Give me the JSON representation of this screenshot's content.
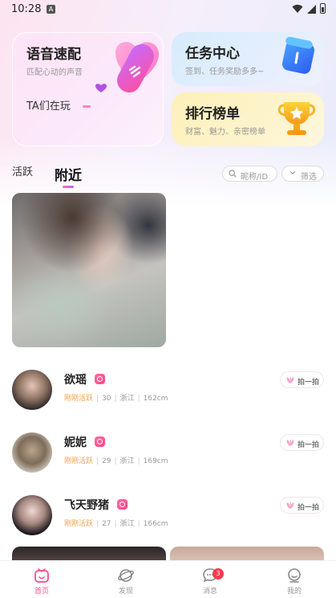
{
  "status_bar": {
    "time": "10:28",
    "notification_letter": "A"
  },
  "cards": {
    "voice_match": {
      "title": "语音速配",
      "subtitle": "匹配心动的声音",
      "tagline": "TA们在玩"
    },
    "task_center": {
      "title": "任务中心",
      "subtitle": "签到、任务奖励多多~"
    },
    "leaderboard": {
      "title": "排行榜单",
      "subtitle": "财富、魅力、亲密榜单"
    }
  },
  "tabs": [
    {
      "label": "活跃",
      "active": false
    },
    {
      "label": "附近",
      "active": true
    }
  ],
  "search": {
    "placeholder": "昵称/ID"
  },
  "filter": {
    "label": "筛选"
  },
  "users": [
    {
      "name": "欲瑶",
      "status": "刚刚活跃",
      "age": "30",
      "location": "浙江",
      "height": "162cm",
      "action": "拍一拍"
    },
    {
      "name": "妮妮",
      "status": "刚刚活跃",
      "age": "29",
      "location": "浙江",
      "height": "169cm",
      "action": "拍一拍"
    },
    {
      "name": "飞天野猪",
      "status": "刚刚活跃",
      "age": "27",
      "location": "浙江",
      "height": "166cm",
      "action": "拍一拍"
    }
  ],
  "bottom_nav": [
    {
      "label": "首页",
      "icon": "home-icon",
      "active": true
    },
    {
      "label": "发现",
      "icon": "planet-icon",
      "active": false
    },
    {
      "label": "消息",
      "icon": "message-icon",
      "active": false,
      "badge": "3"
    },
    {
      "label": "我的",
      "icon": "profile-icon",
      "active": false
    }
  ],
  "colors": {
    "accent_pink": "#ff4f8e",
    "active_orange": "#f0a34a",
    "badge_red": "#ff3b4e"
  }
}
